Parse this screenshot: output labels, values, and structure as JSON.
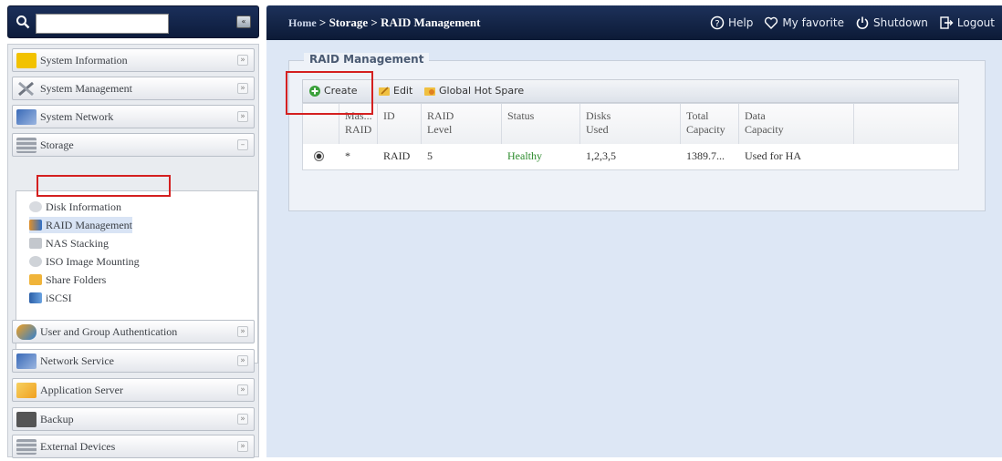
{
  "search": {
    "placeholder": "",
    "collapse_glyph": "«"
  },
  "sidebar": {
    "categories": [
      {
        "label": "System Information",
        "icon": "info-icon",
        "color": "#f2c200"
      },
      {
        "label": "System Management",
        "icon": "tools-icon",
        "color": "#8a8f99"
      },
      {
        "label": "System Network",
        "icon": "network-icon",
        "color": "#3a6ab8"
      },
      {
        "label": "Storage",
        "icon": "storage-icon",
        "color": "#9aa0aa"
      },
      {
        "label": "User and Group Authentication",
        "icon": "users-icon",
        "color": "#2f7fd0"
      },
      {
        "label": "Network Service",
        "icon": "network-service-icon",
        "color": "#3a6ab8"
      },
      {
        "label": "Application Server",
        "icon": "application-icon",
        "color": "#f0a020"
      },
      {
        "label": "Backup",
        "icon": "backup-icon",
        "color": "#555555"
      },
      {
        "label": "External Devices",
        "icon": "external-devices-icon",
        "color": "#9aa0aa"
      }
    ],
    "chevron_glyph": "»",
    "storage_items": [
      {
        "label": "Disk Information",
        "icon": "disk-icon"
      },
      {
        "label": "RAID Management",
        "icon": "raid-icon",
        "selected": true
      },
      {
        "label": "NAS Stacking",
        "icon": "stacking-icon"
      },
      {
        "label": "ISO Image Mounting",
        "icon": "iso-icon"
      },
      {
        "label": "Share Folders",
        "icon": "folder-icon"
      },
      {
        "label": "iSCSI",
        "icon": "iscsi-icon"
      }
    ]
  },
  "header": {
    "breadcrumb_home": "Home",
    "breadcrumb_rest": " > Storage > RAID Management",
    "help": "Help",
    "favorite": "My favorite",
    "shutdown": "Shutdown",
    "logout": "Logout"
  },
  "main": {
    "section_title": "RAID Management",
    "toolbar": {
      "create": "Create",
      "edit": "Edit",
      "global_hot_spare": "Global Hot Spare"
    },
    "columns": [
      {
        "line1": "Mas...",
        "line2": "RAID"
      },
      {
        "line1": "ID",
        "line2": ""
      },
      {
        "line1": "RAID",
        "line2": "Level"
      },
      {
        "line1": "Status",
        "line2": ""
      },
      {
        "line1": "Disks",
        "line2": "Used"
      },
      {
        "line1": "Total",
        "line2": "Capacity"
      },
      {
        "line1": "Data",
        "line2": "Capacity"
      }
    ],
    "rows": [
      {
        "master": "*",
        "id": "RAID",
        "level": "5",
        "status": "Healthy",
        "disks": "1,2,3,5",
        "total": "1389.7...",
        "data": "Used for HA"
      }
    ]
  },
  "colors": {
    "topbar": "#13244a",
    "healthy": "#2a8a2a",
    "highlight": "#d42020",
    "content_bg": "#dde7f5"
  }
}
